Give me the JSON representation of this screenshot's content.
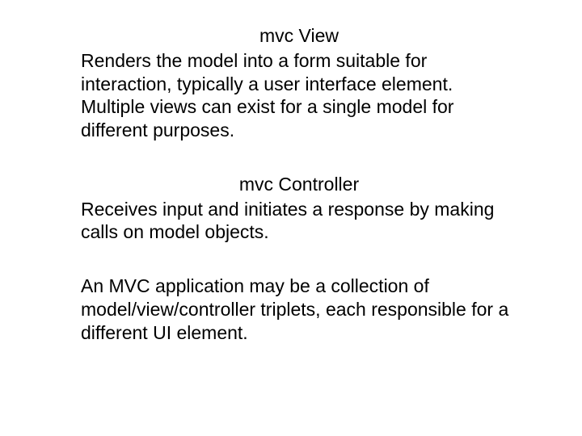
{
  "sections": [
    {
      "heading": "mvc View",
      "body": "Renders the model into a form suitable for interaction, typically a user interface element. Multiple views can exist for a single model for different purposes."
    },
    {
      "heading": "mvc Controller",
      "body": "Receives input and initiates a response by making calls on model objects."
    },
    {
      "heading": "",
      "body": "An MVC application may be a collection of model/view/controller triplets, each responsible for a different UI element."
    }
  ]
}
